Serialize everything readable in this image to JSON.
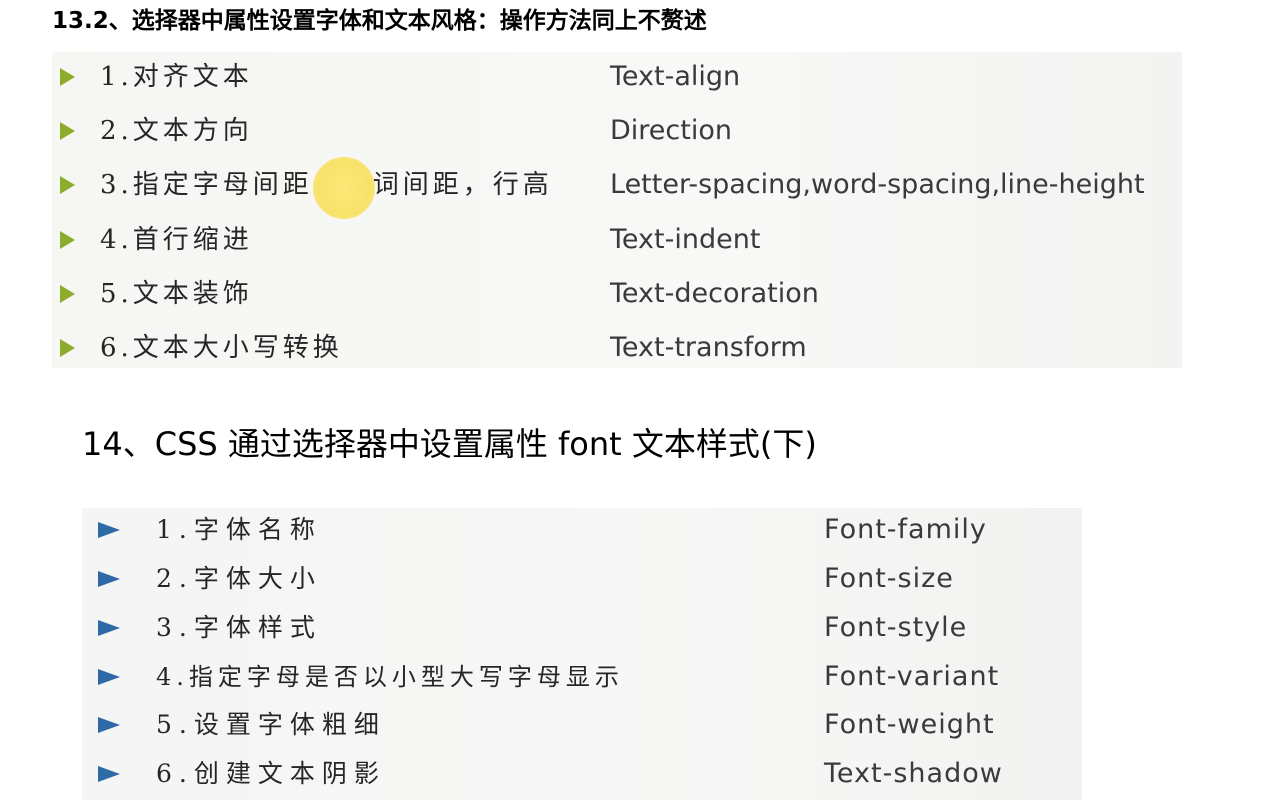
{
  "section_13": {
    "heading": "13.2、选择器中属性设置字体和文本风格：操作方法同上不赘述",
    "items": [
      {
        "label": "1.对齐文本",
        "property": "Text-align"
      },
      {
        "label": "2.文本方向",
        "property": "Direction"
      },
      {
        "label": "3.指定字母间距，单词间距，行高",
        "property": "Letter-spacing,word-spacing,line-height"
      },
      {
        "label": "4.首行缩进",
        "property": "Text-indent"
      },
      {
        "label": "5.文本装饰",
        "property": "Text-decoration"
      },
      {
        "label": "6.文本大小写转换",
        "property": "Text-transform"
      }
    ]
  },
  "section_14": {
    "heading": "14、CSS 通过选择器中设置属性 font 文本样式(下)",
    "items": [
      {
        "label": "1.字体名称",
        "property": "Font-family"
      },
      {
        "label": "2.字体大小",
        "property": "Font-size"
      },
      {
        "label": "3.字体样式",
        "property": "Font-style"
      },
      {
        "label": "4.指定字母是否以小型大写字母显示",
        "property": "Font-variant"
      },
      {
        "label": "5.设置字体粗细",
        "property": "Font-weight"
      },
      {
        "label": "6.创建文本阴影",
        "property": "Text-shadow"
      }
    ]
  },
  "colors": {
    "bullet_green": "#8dac2e",
    "bullet_blue": "#2e6aa6",
    "cursor_highlight": "#f9e26a"
  }
}
